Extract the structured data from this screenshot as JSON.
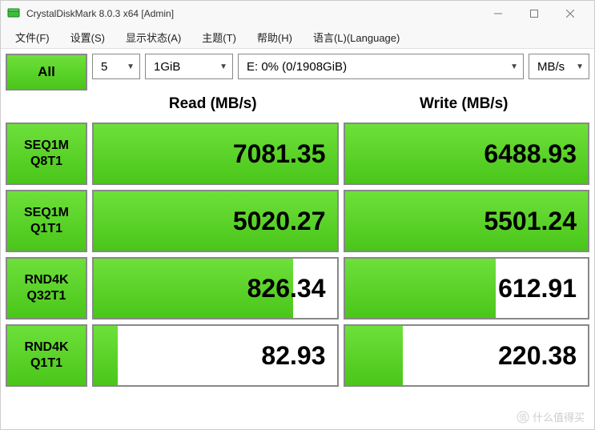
{
  "titlebar": {
    "title": "CrystalDiskMark 8.0.3 x64 [Admin]"
  },
  "menu": {
    "file": "文件(F)",
    "settings": "设置(S)",
    "display": "显示状态(A)",
    "theme": "主题(T)",
    "help": "帮助(H)",
    "language": "语言(L)(Language)"
  },
  "controls": {
    "all": "All",
    "count": "5",
    "size": "1GiB",
    "drive": "E: 0% (0/1908GiB)",
    "unit": "MB/s"
  },
  "headers": {
    "read": "Read (MB/s)",
    "write": "Write (MB/s)"
  },
  "tests": [
    {
      "label1": "SEQ1M",
      "label2": "Q8T1",
      "read": "7081.35",
      "read_pct": 100,
      "write": "6488.93",
      "write_pct": 100
    },
    {
      "label1": "SEQ1M",
      "label2": "Q1T1",
      "read": "5020.27",
      "read_pct": 100,
      "write": "5501.24",
      "write_pct": 100
    },
    {
      "label1": "RND4K",
      "label2": "Q32T1",
      "read": "826.34",
      "read_pct": 82,
      "write": "612.91",
      "write_pct": 62
    },
    {
      "label1": "RND4K",
      "label2": "Q1T1",
      "read": "82.93",
      "read_pct": 10,
      "write": "220.38",
      "write_pct": 24
    }
  ],
  "watermark": "什么值得买"
}
